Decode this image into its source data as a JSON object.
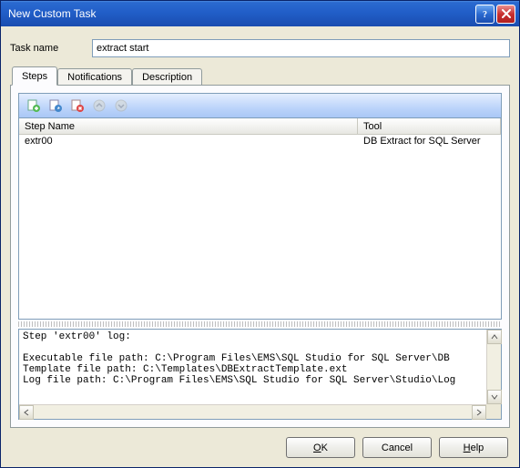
{
  "window": {
    "title": "New Custom Task"
  },
  "task_name": {
    "label": "Task name",
    "value": "extract start"
  },
  "tabs": [
    {
      "label": "Steps",
      "active": true
    },
    {
      "label": "Notifications",
      "active": false
    },
    {
      "label": "Description",
      "active": false
    }
  ],
  "toolbar_icons": {
    "add_step": "add-step",
    "edit_step": "edit-step",
    "delete_step": "delete-step",
    "move_up": "move-up",
    "move_down": "move-down"
  },
  "grid": {
    "columns": {
      "step_name": "Step Name",
      "tool": "Tool"
    },
    "rows": [
      {
        "step_name": "extr00",
        "tool": "DB Extract for SQL Server"
      }
    ]
  },
  "log": {
    "lines": [
      "Step 'extr00' log:",
      "",
      "Executable file path: C:\\Program Files\\EMS\\SQL Studio for SQL Server\\DB",
      "Template file path: C:\\Templates\\DBExtractTemplate.ext",
      "Log file path: C:\\Program Files\\EMS\\SQL Studio for SQL Server\\Studio\\Log"
    ]
  },
  "buttons": {
    "ok": "OK",
    "cancel": "Cancel",
    "help": "Help"
  },
  "colors": {
    "titlebar": "#215ec8",
    "panel": "#ece9d8",
    "toolbar_grad_top": "#e4eefe",
    "toolbar_grad_bot": "#a9c7f6",
    "border": "#7f9db9"
  }
}
